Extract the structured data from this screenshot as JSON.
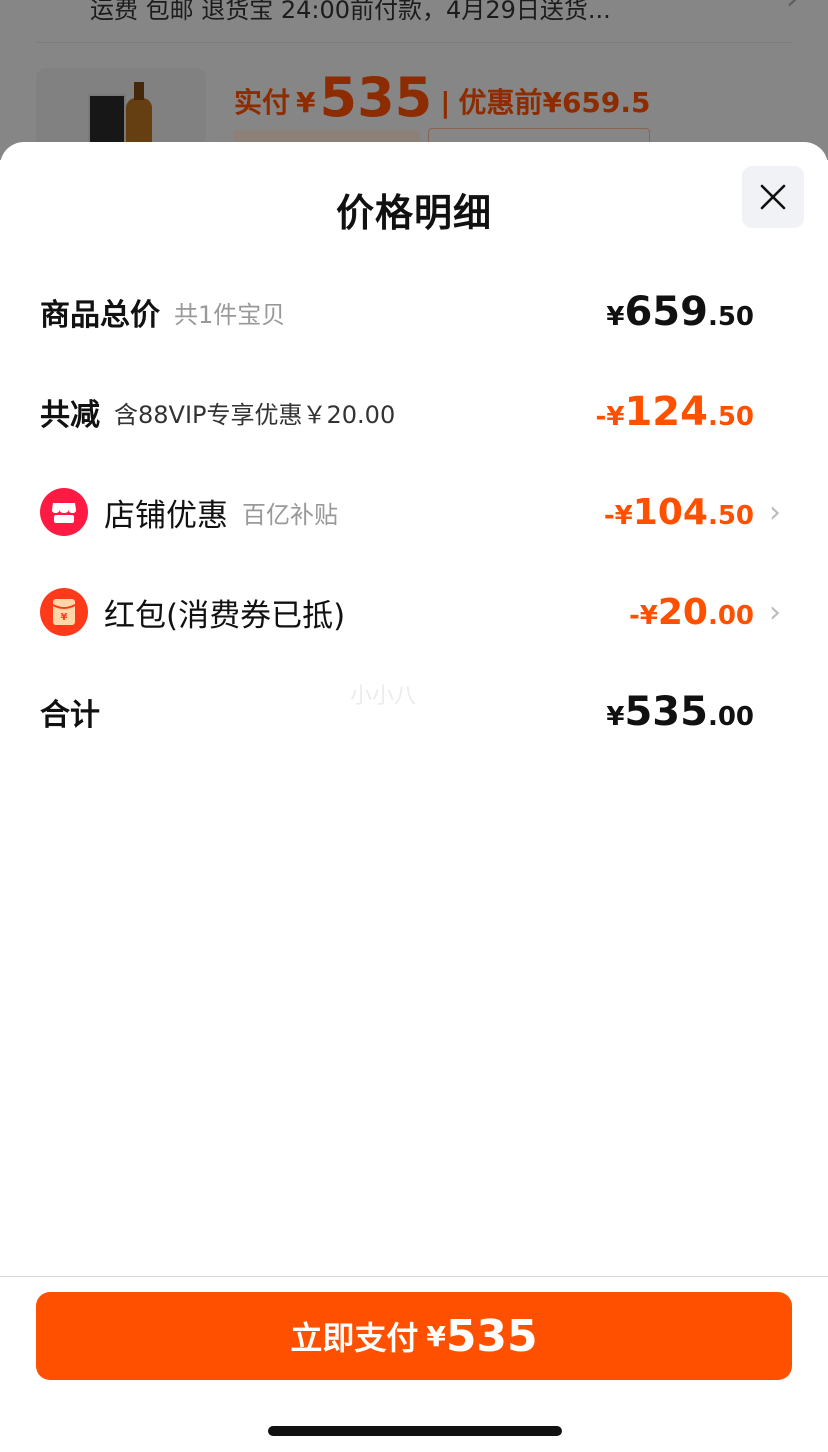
{
  "background_page": {
    "shipping_text": "运费 包邮 退货宝 24:00前付款，4月29日送货...",
    "paid_label": "实付",
    "currency": "¥",
    "paid_amount": "535",
    "separator": "|",
    "before_discount": "优惠前¥659.5"
  },
  "sheet": {
    "title": "价格明细"
  },
  "rows": {
    "total": {
      "label": "商品总价",
      "sub": "共1件宝贝",
      "currency": "¥",
      "int": "659",
      "dec": ".50"
    },
    "discount": {
      "label": "共减",
      "sub": "含88VIP专享优惠￥20.00",
      "prefix": "-¥",
      "int": "124",
      "dec": ".50"
    },
    "shop": {
      "label": "店铺优惠",
      "sub": "百亿补贴",
      "prefix": "-¥",
      "int": "104",
      "dec": ".50",
      "icon": "shop-icon"
    },
    "redpacket": {
      "label": "红包(消费券已抵)",
      "prefix": "-¥",
      "int": "20",
      "dec": ".00",
      "icon": "red-packet-icon"
    },
    "sum": {
      "label": "合计",
      "currency": "¥",
      "int": "535",
      "dec": ".00"
    }
  },
  "watermark": "小小八",
  "footer": {
    "pay_label": "立即支付",
    "currency": "¥",
    "pay_amount": "535"
  },
  "colors": {
    "accent": "#ff5000",
    "shop_icon_bg": "#ff1a44",
    "redpacket_icon_bg": "#ff3a1a"
  }
}
